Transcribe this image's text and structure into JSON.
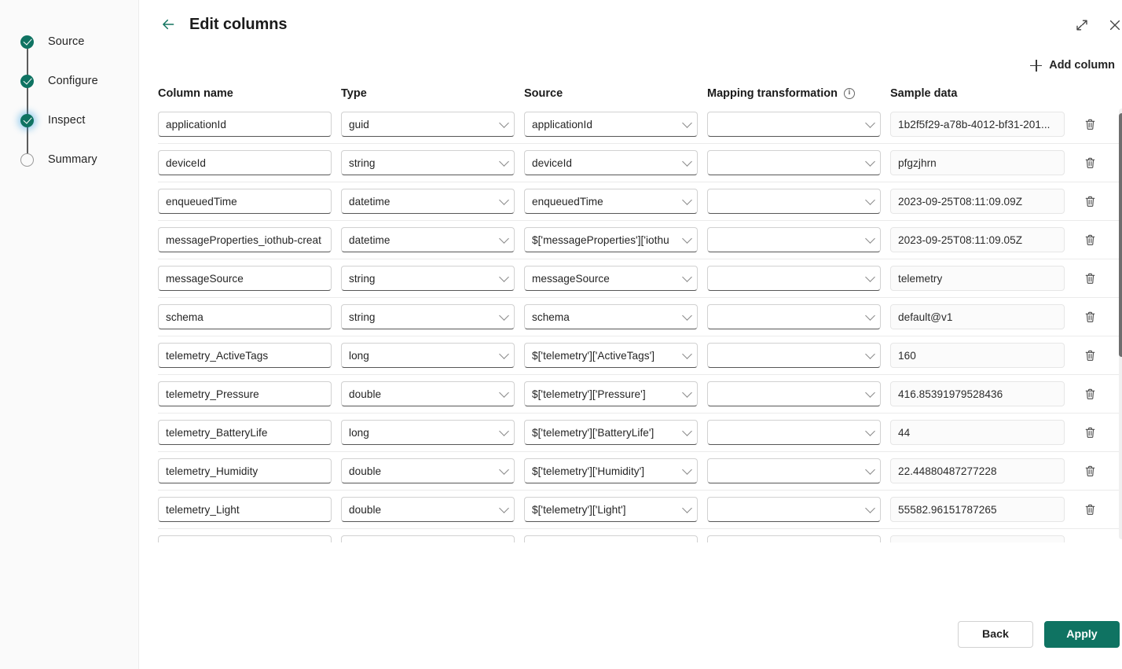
{
  "wizard": {
    "steps": [
      {
        "label": "Source",
        "state": "done"
      },
      {
        "label": "Configure",
        "state": "done"
      },
      {
        "label": "Inspect",
        "state": "current"
      },
      {
        "label": "Summary",
        "state": "pending"
      }
    ]
  },
  "header": {
    "title": "Edit columns",
    "back_icon": "arrow-left-icon",
    "expand_icon": "expand-diagonal-icon",
    "close_icon": "close-icon"
  },
  "toolbar": {
    "add_column_label": "Add column",
    "add_icon": "plus-icon"
  },
  "table": {
    "headers": {
      "column_name": "Column name",
      "type": "Type",
      "source": "Source",
      "mapping_transformation": "Mapping transformation",
      "mapping_info_icon": "info-icon",
      "sample_data": "Sample data"
    },
    "rows": [
      {
        "column_name": "applicationId",
        "type": "guid",
        "source": "applicationId",
        "mapping_transformation": "",
        "sample_data": "1b2f5f29-a78b-4012-bf31-201..."
      },
      {
        "column_name": "deviceId",
        "type": "string",
        "source": "deviceId",
        "mapping_transformation": "",
        "sample_data": "pfgzjhrn"
      },
      {
        "column_name": "enqueuedTime",
        "type": "datetime",
        "source": "enqueuedTime",
        "mapping_transformation": "",
        "sample_data": "2023-09-25T08:11:09.09Z"
      },
      {
        "column_name": "messageProperties_iothub-creat",
        "type": "datetime",
        "source": "$['messageProperties']['iothu",
        "mapping_transformation": "",
        "sample_data": "2023-09-25T08:11:09.05Z"
      },
      {
        "column_name": "messageSource",
        "type": "string",
        "source": "messageSource",
        "mapping_transformation": "",
        "sample_data": "telemetry"
      },
      {
        "column_name": "schema",
        "type": "string",
        "source": "schema",
        "mapping_transformation": "",
        "sample_data": "default@v1"
      },
      {
        "column_name": "telemetry_ActiveTags",
        "type": "long",
        "source": "$['telemetry']['ActiveTags']",
        "mapping_transformation": "",
        "sample_data": "160"
      },
      {
        "column_name": "telemetry_Pressure",
        "type": "double",
        "source": "$['telemetry']['Pressure']",
        "mapping_transformation": "",
        "sample_data": "416.85391979528436"
      },
      {
        "column_name": "telemetry_BatteryLife",
        "type": "long",
        "source": "$['telemetry']['BatteryLife']",
        "mapping_transformation": "",
        "sample_data": "44"
      },
      {
        "column_name": "telemetry_Humidity",
        "type": "double",
        "source": "$['telemetry']['Humidity']",
        "mapping_transformation": "",
        "sample_data": "22.44880487277228"
      },
      {
        "column_name": "telemetry_Light",
        "type": "double",
        "source": "$['telemetry']['Light']",
        "mapping_transformation": "",
        "sample_data": "55582.96151787265"
      },
      {
        "column_name": "",
        "type": "",
        "source": "",
        "mapping_transformation": "",
        "sample_data": ""
      }
    ],
    "delete_icon": "trash-icon"
  },
  "footer": {
    "back_label": "Back",
    "apply_label": "Apply"
  },
  "colors": {
    "accent": "#0f7362",
    "accent_link": "#12745f",
    "text": "#242424",
    "border": "#d1d1d1",
    "rail_bg": "#fafafa"
  }
}
